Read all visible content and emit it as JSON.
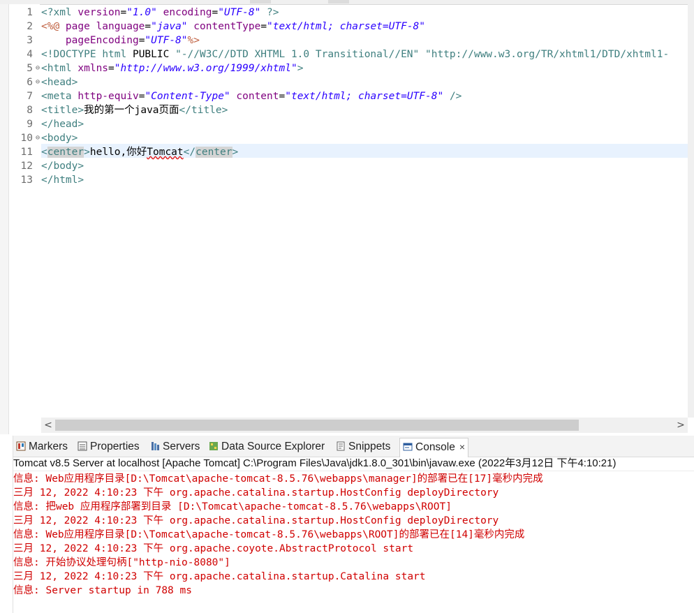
{
  "editor": {
    "lines": [
      {
        "n": "1",
        "segs": [
          [
            "c-tag",
            "<?xml "
          ],
          [
            "c-attr",
            "version"
          ],
          [
            "c-text",
            "="
          ],
          [
            "c-val",
            "\"1.0\""
          ],
          [
            "c-text",
            " "
          ],
          [
            "c-attr",
            "encoding"
          ],
          [
            "c-text",
            "="
          ],
          [
            "c-val",
            "\"UTF-8\""
          ],
          [
            "c-tag",
            " ?>"
          ]
        ]
      },
      {
        "n": "2",
        "segs": [
          [
            "c-jsp",
            "<%@ "
          ],
          [
            "c-attr",
            "page "
          ],
          [
            "c-attr",
            "language"
          ],
          [
            "c-text",
            "="
          ],
          [
            "c-val",
            "\"java\""
          ],
          [
            "c-text",
            " "
          ],
          [
            "c-attr",
            "contentType"
          ],
          [
            "c-text",
            "="
          ],
          [
            "c-val",
            "\"text/html; charset=UTF-8\""
          ]
        ]
      },
      {
        "n": "3",
        "segs": [
          [
            "c-text",
            "    "
          ],
          [
            "c-attr",
            "pageEncoding"
          ],
          [
            "c-text",
            "="
          ],
          [
            "c-val",
            "\"UTF-8\""
          ],
          [
            "c-jsp",
            "%>"
          ]
        ]
      },
      {
        "n": "4",
        "segs": [
          [
            "c-tag",
            "<!DOCTYPE "
          ],
          [
            "c-doctype-kw",
            "html "
          ],
          [
            "c-text",
            "PUBLIC "
          ],
          [
            "c-doctype-str",
            "\"-//W3C//DTD XHTML 1.0 Transitional//EN\" \"http://www.w3.org/TR/xhtml1/DTD/xhtml1-"
          ]
        ]
      },
      {
        "n": "5",
        "fold": true,
        "segs": [
          [
            "c-tag",
            "<html "
          ],
          [
            "c-attr",
            "xmlns"
          ],
          [
            "c-text",
            "="
          ],
          [
            "c-val",
            "\"http://www.w3.org/1999/xhtml\""
          ],
          [
            "c-tag",
            ">"
          ]
        ]
      },
      {
        "n": "6",
        "fold": true,
        "segs": [
          [
            "c-tag",
            "<head>"
          ]
        ]
      },
      {
        "n": "7",
        "segs": [
          [
            "c-tag",
            "<meta "
          ],
          [
            "c-attr",
            "http-equiv"
          ],
          [
            "c-text",
            "="
          ],
          [
            "c-val",
            "\"Content-Type\""
          ],
          [
            "c-text",
            " "
          ],
          [
            "c-attr",
            "content"
          ],
          [
            "c-text",
            "="
          ],
          [
            "c-val",
            "\"text/html; charset=UTF-8\""
          ],
          [
            "c-tag",
            " />"
          ]
        ]
      },
      {
        "n": "8",
        "segs": [
          [
            "c-tag",
            "<title>"
          ],
          [
            "c-text",
            "我的第一个java页面"
          ],
          [
            "c-tag",
            "</title>"
          ]
        ]
      },
      {
        "n": "9",
        "segs": [
          [
            "c-tag",
            "</head>"
          ]
        ]
      },
      {
        "n": "10",
        "fold": true,
        "segs": [
          [
            "c-tag",
            "<body>"
          ]
        ]
      },
      {
        "n": "11",
        "segs": [
          [
            "c-tag",
            "<"
          ],
          [
            "c-center",
            "center"
          ],
          [
            "c-tag",
            ">"
          ],
          [
            "c-text",
            "hello,你好"
          ],
          [
            "c-text squiggle",
            "Tomcat"
          ],
          [
            "c-tag",
            "</"
          ],
          [
            "c-center",
            "center"
          ],
          [
            "c-tag",
            ">"
          ]
        ]
      },
      {
        "n": "12",
        "segs": [
          [
            "c-tag",
            "</body>"
          ]
        ]
      },
      {
        "n": "13",
        "segs": [
          [
            "c-tag",
            "</html>"
          ]
        ]
      }
    ]
  },
  "panel": {
    "tabs": [
      {
        "name": "tab-markers",
        "label": "Markers",
        "icon": "markers-icon"
      },
      {
        "name": "tab-properties",
        "label": "Properties",
        "icon": "properties-icon"
      },
      {
        "name": "tab-servers",
        "label": "Servers",
        "icon": "servers-icon"
      },
      {
        "name": "tab-data-source-explorer",
        "label": "Data Source Explorer",
        "icon": "data-source-icon"
      },
      {
        "name": "tab-snippets",
        "label": "Snippets",
        "icon": "snippets-icon"
      },
      {
        "name": "tab-console",
        "label": "Console",
        "icon": "console-icon",
        "active": true
      }
    ],
    "close_glyph": "×"
  },
  "console": {
    "header": "Tomcat v8.5 Server at localhost [Apache Tomcat] C:\\Program Files\\Java\\jdk1.8.0_301\\bin\\javaw.exe  (2022年3月12日 下午4:10:21)",
    "logs": [
      "信息: Web应用程序目录[D:\\Tomcat\\apache-tomcat-8.5.76\\webapps\\manager]的部署已在[17]毫秒内完成",
      "三月 12, 2022 4:10:23 下午 org.apache.catalina.startup.HostConfig deployDirectory",
      "信息: 把web 应用程序部署到目录 [D:\\Tomcat\\apache-tomcat-8.5.76\\webapps\\ROOT]",
      "三月 12, 2022 4:10:23 下午 org.apache.catalina.startup.HostConfig deployDirectory",
      "信息: Web应用程序目录[D:\\Tomcat\\apache-tomcat-8.5.76\\webapps\\ROOT]的部署已在[14]毫秒内完成",
      "三月 12, 2022 4:10:23 下午 org.apache.coyote.AbstractProtocol start",
      "信息: 开始协议处理句柄[\"http-nio-8080\"]",
      "三月 12, 2022 4:10:23 下午 org.apache.catalina.startup.Catalina start",
      "信息: Server startup in 788 ms"
    ],
    "log_color": "#d00000"
  },
  "scroll": {
    "left_arrow": "<",
    "right_arrow": ">"
  }
}
